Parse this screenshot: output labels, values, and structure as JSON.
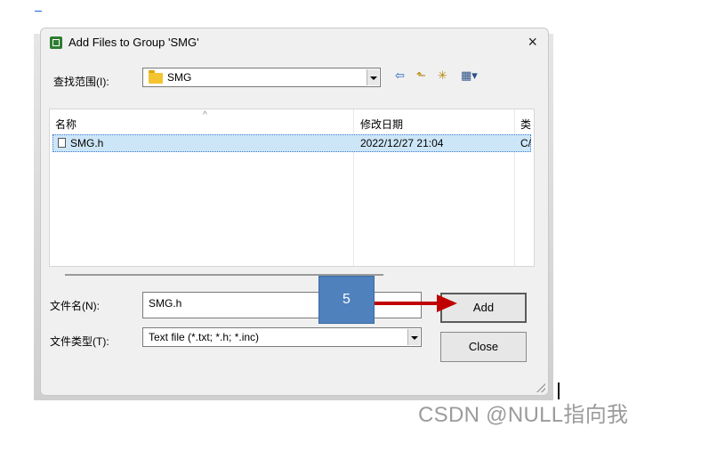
{
  "dialog": {
    "title": "Add Files to Group 'SMG'",
    "close_label": "×"
  },
  "look_in": {
    "label": "查找范围(I):",
    "value": "SMG"
  },
  "toolbar": {
    "back_glyph": "⇦",
    "up_glyph": "⬑",
    "new_folder_glyph": "✳",
    "view_glyph": "▦▾"
  },
  "file_list": {
    "columns": [
      "名称",
      "修改日期",
      "类"
    ],
    "rows": [
      {
        "name": "SMG.h",
        "modified": "2022/12/27 21:04",
        "type": "C/"
      }
    ]
  },
  "file_name": {
    "label": "文件名(N):",
    "value": "SMG.h"
  },
  "file_type": {
    "label": "文件类型(T):",
    "value": "Text file (*.txt; *.h; *.inc)"
  },
  "buttons": {
    "add": "Add",
    "close": "Close"
  },
  "annotation": {
    "step": "5",
    "arrow_color": "#c00000",
    "box_color": "#4f81bd"
  },
  "watermark": "CSDN @NULL指向我",
  "icons": [
    "app-icon",
    "close-icon",
    "folder-icon",
    "back-icon",
    "up-folder-icon",
    "new-folder-icon",
    "view-menu-icon",
    "file-icon",
    "dropdown-arrow-icon",
    "resize-grip-icon"
  ]
}
